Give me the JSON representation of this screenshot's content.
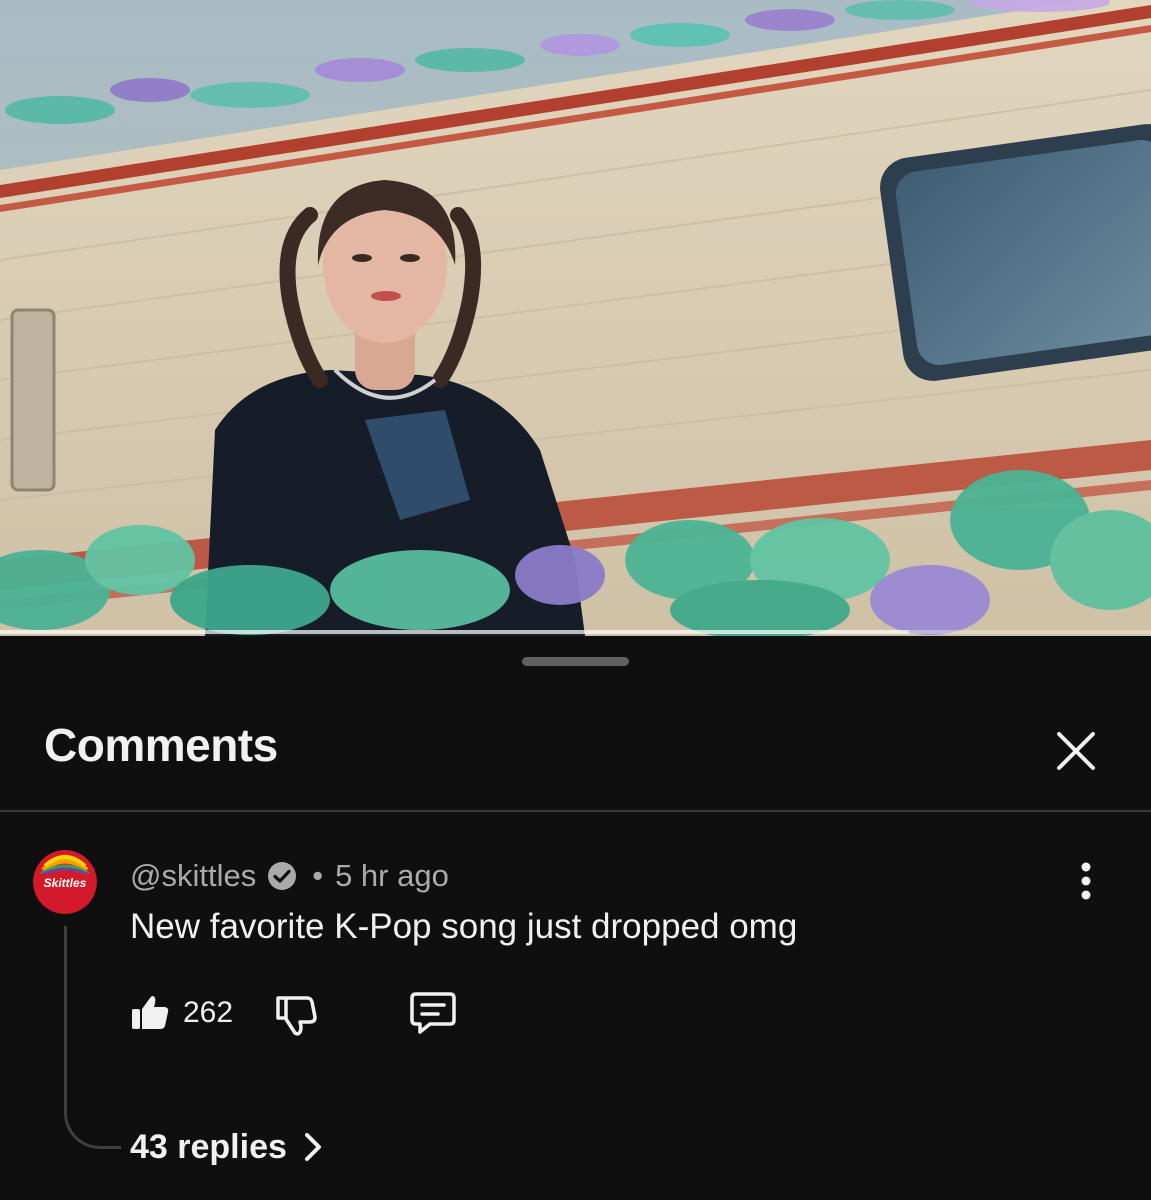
{
  "video": {
    "progress": 0.79
  },
  "comments_panel": {
    "title": "Comments",
    "close_icon": "close-icon"
  },
  "comment": {
    "author": "@skittles",
    "verified": true,
    "separator": "•",
    "time": "5 hr ago",
    "text": "New favorite K-Pop song just dropped omg",
    "like_count": "262",
    "avatar_logo_text": "Skittles",
    "replies_label": "43 replies",
    "icons": {
      "like": "thumbs-up-icon",
      "dislike": "thumbs-down-icon",
      "reply": "reply-comment-icon",
      "more": "more-vertical-icon",
      "verified": "verified-check-icon",
      "chevron": "chevron-right-icon"
    }
  },
  "colors": {
    "background": "#0f0f0f",
    "primary_text": "#f1f1f1",
    "secondary_text": "#aaaaaa",
    "divider": "#3a3a3a"
  }
}
